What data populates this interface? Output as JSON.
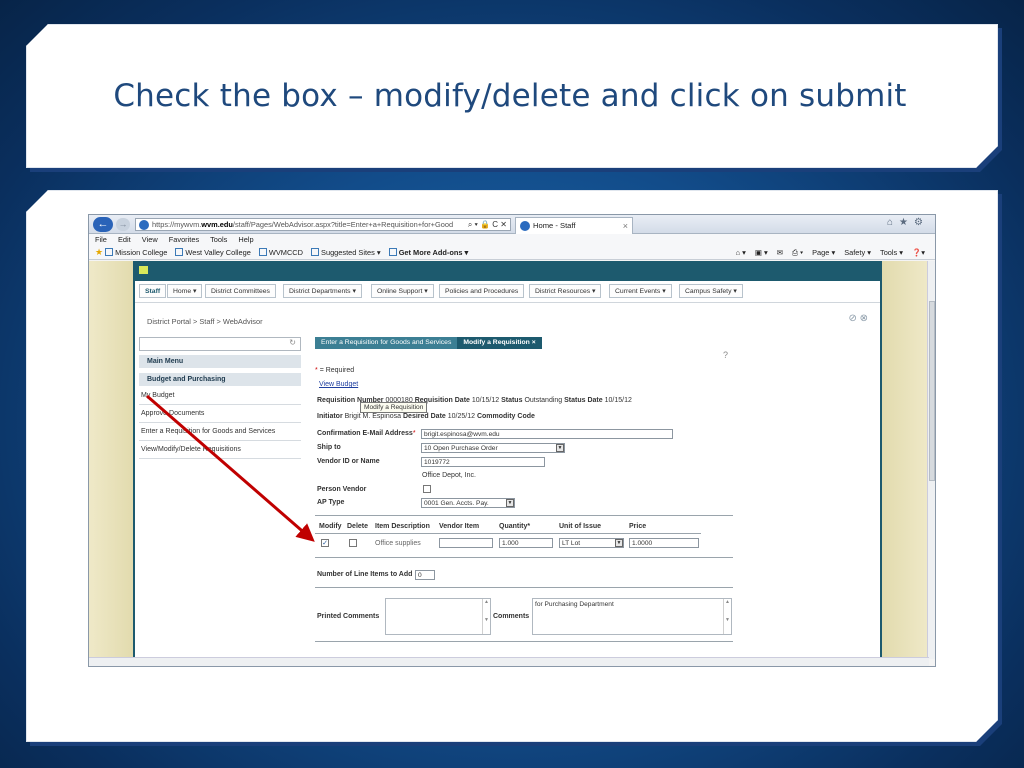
{
  "slide": {
    "title": "Check the box – modify/delete and click on submit"
  },
  "browser": {
    "url_prefix": "https://mywvm.",
    "url_domain": "wvm.edu",
    "url_path": "/staff/Pages/WebAdvisor.aspx?title=Enter+a+Requisition+for+Good",
    "url_tools": "⌕ ▾ 🔒 C ✕",
    "tab_title": "Home - Staff",
    "tab_close": "×",
    "menu": [
      "File",
      "Edit",
      "View",
      "Favorites",
      "Tools",
      "Help"
    ],
    "favorites": [
      "Mission College",
      "West Valley College",
      "WVMCCD",
      "Suggested Sites ▾",
      "Get More Add-ons ▾"
    ],
    "command_bar": [
      "Page ▾",
      "Safety ▾",
      "Tools ▾"
    ]
  },
  "site": {
    "nav": [
      "Staff",
      "Home ▾",
      "District Committees",
      "District Departments ▾",
      "Online Support ▾",
      "Policies and Procedures",
      "District Resources ▾",
      "Current Events ▾",
      "Campus Safety ▾"
    ],
    "breadcrumb": "District Portal >  Staff >  WebAdvisor"
  },
  "leftnav": {
    "refresh_icon": "↻",
    "main_menu": "Main Menu",
    "section": "Budget and Purchasing",
    "items": [
      "My Budget",
      "Approve Documents",
      "Enter a Requisition for Goods and Services",
      "View/Modify/Delete Requisitions"
    ]
  },
  "form": {
    "tab1": "Enter a Requisition for Goods and Services",
    "tab2": "Modify a Requisition ×",
    "required_note": "= Required",
    "required_mark": "*",
    "view_budget": "View Budget",
    "req_number_label": "Requisition Number",
    "req_number": "0000180",
    "req_date_label": "Requisition Date",
    "req_date": "10/15/12",
    "status_label": "Status",
    "status": "Outstanding",
    "status_date_label": "Status Date",
    "status_date": "10/15/12",
    "initiator_label": "Initiator",
    "initiator": "Brigit M. Espinosa",
    "desired_date_label": "Desired Date",
    "desired_date": "10/25/12",
    "commodity_label": "Commodity Code",
    "tooltip": "Modify a Requisition",
    "email_label": "Confirmation E-Mail Address",
    "email": "brigit.espinosa@wvm.edu",
    "ship_to_label": "Ship to",
    "ship_to": "10 Open Purchase Order",
    "vendor_label": "Vendor ID or Name",
    "vendor_id": "1019772",
    "vendor_name": "Office Depot, Inc.",
    "person_vendor_label": "Person Vendor",
    "ap_type_label": "AP Type",
    "ap_type": "0001 Gen. Accts. Pay.",
    "columns": [
      "Modify",
      "Delete",
      "Item Description",
      "Vendor Item",
      "Quantity*",
      "Unit of Issue",
      "Price"
    ],
    "row": {
      "modify_checked": "✓",
      "description": "Office supplies",
      "vendor_item": "",
      "quantity": "1.000",
      "unit": "LT Lot",
      "price": "1.0000"
    },
    "line_items_label": "Number of Line Items to Add",
    "line_items": "0",
    "printed_comments_label": "Printed Comments",
    "comments_label": "Comments",
    "comments": "for Purchasing Department"
  },
  "colors": {
    "slide_title": "#1f497d",
    "site_bar": "#1d5a6e",
    "annotation_arrow": "#c00000"
  }
}
